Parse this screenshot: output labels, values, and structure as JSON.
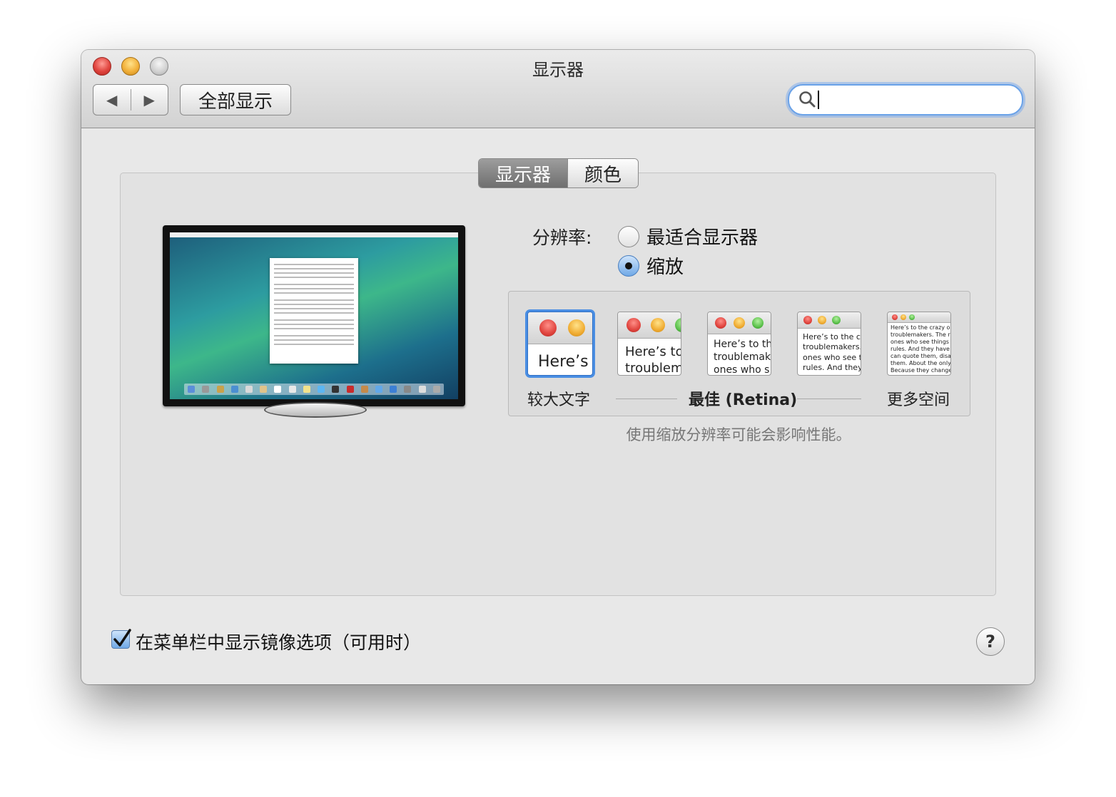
{
  "window": {
    "title": "显示器"
  },
  "toolbar": {
    "back_icon": "back-arrow-icon",
    "forward_icon": "forward-arrow-icon",
    "show_all_label": "全部显示",
    "search_value": "",
    "search_icon": "magnifier-icon"
  },
  "tabs": [
    {
      "label": "显示器",
      "active": true
    },
    {
      "label": "颜色",
      "active": false
    }
  ],
  "resolution": {
    "label": "分辨率:",
    "options": [
      {
        "label": "最适合显示器",
        "selected": false
      },
      {
        "label": "缩放",
        "selected": true
      }
    ]
  },
  "scaling": {
    "options": [
      {
        "text": "Here’s",
        "selected": true
      },
      {
        "text": "Here’s to\ntroublem",
        "selected": false
      },
      {
        "text": "Here’s to th\ntroublemak\nones who s",
        "selected": false
      },
      {
        "text": "Here’s to the cr\ntroublemakers.\nones who see t\nrules. And they",
        "selected": false
      },
      {
        "text": "Here’s to the crazy ones\ntroublemakers. The rou\nones who see things dif\nrules. And they have no\ncan quote them, disagre\nthem. About the only th\nBecause they change th",
        "selected": false
      }
    ],
    "label_larger": "较大文字",
    "label_best": "最佳 (Retina)",
    "label_more": "更多空间",
    "note": "使用缩放分辨率可能会影响性能。"
  },
  "mirroring": {
    "label": "在菜单栏中显示镜像选项（可用时）",
    "checked": true
  },
  "help": {
    "label": "?"
  },
  "colors": {
    "accent": "#4a8ee3"
  }
}
